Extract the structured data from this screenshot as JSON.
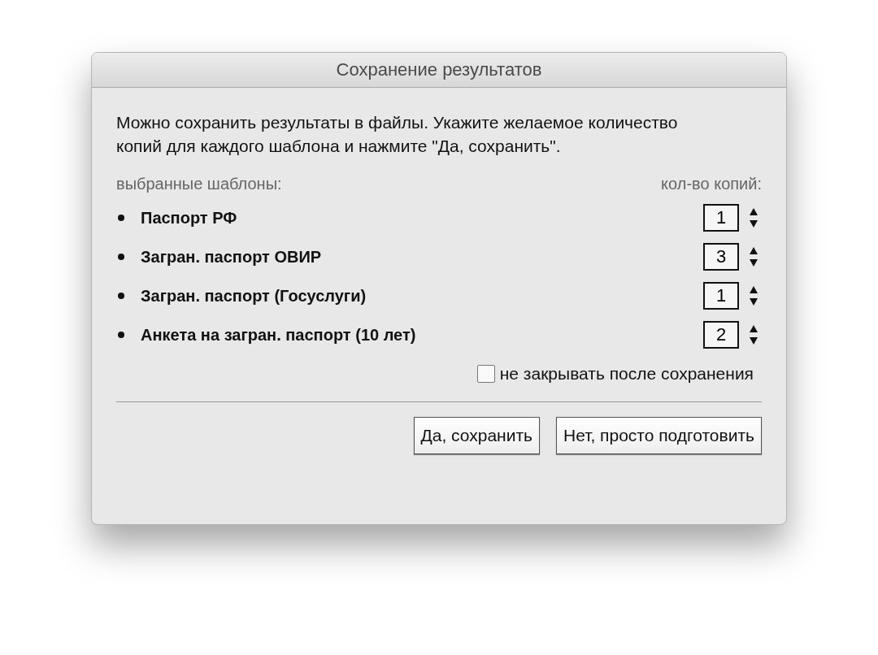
{
  "window": {
    "title": "Сохранение результатов"
  },
  "message": "Можно сохранить результаты в файлы. Укажите желаемое количество копий для каждого шаблона и нажмите \"Да, сохранить\".",
  "templates_header": "выбранные шаблоны:",
  "copies_header": "кол-во копий:",
  "templates": [
    {
      "name": "Паспорт РФ",
      "copies": "1"
    },
    {
      "name": "Загран. паспорт ОВИР",
      "copies": "3"
    },
    {
      "name": "Загран. паспорт (Госуслуги)",
      "copies": "1"
    },
    {
      "name": "Анкета на загран. паспорт (10 лет)",
      "copies": "2"
    }
  ],
  "keep_open": {
    "label": "не закрывать после сохранения",
    "checked": false
  },
  "buttons": [
    "Да, сохранить",
    "Нет, просто подготовить"
  ]
}
